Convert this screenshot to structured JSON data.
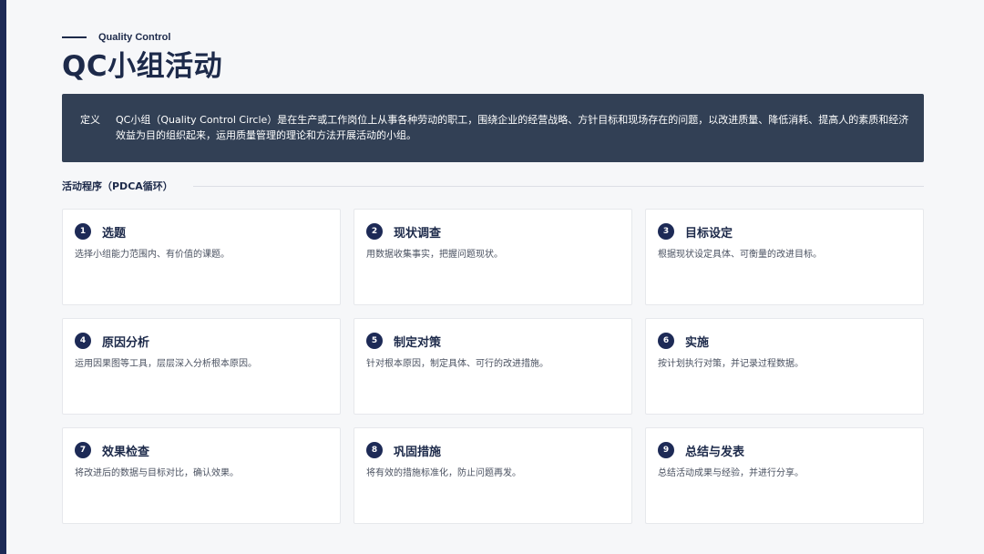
{
  "header": {
    "subtitle": "Quality Control",
    "title": "QC小组活动"
  },
  "definition": {
    "label": "定义",
    "text": "QC小组（Quality Control Circle）是在生产或工作岗位上从事各种劳动的职工，围绕企业的经营战略、方针目标和现场存在的问题，以改进质量、降低消耗、提高人的素质和经济效益为目的组织起来，运用质量管理的理论和方法开展活动的小组。"
  },
  "section": {
    "title": "活动程序（PDCA循环）"
  },
  "steps": [
    {
      "num": "1",
      "title": "选题",
      "desc": "选择小组能力范围内、有价值的课题。"
    },
    {
      "num": "2",
      "title": "现状调查",
      "desc": "用数据收集事实，把握问题现状。"
    },
    {
      "num": "3",
      "title": "目标设定",
      "desc": "根据现状设定具体、可衡量的改进目标。"
    },
    {
      "num": "4",
      "title": "原因分析",
      "desc": "运用因果图等工具，层层深入分析根本原因。"
    },
    {
      "num": "5",
      "title": "制定对策",
      "desc": "针对根本原因，制定具体、可行的改进措施。"
    },
    {
      "num": "6",
      "title": "实施",
      "desc": "按计划执行对策，并记录过程数据。"
    },
    {
      "num": "7",
      "title": "效果检查",
      "desc": "将改进后的数据与目标对比，确认效果。"
    },
    {
      "num": "8",
      "title": "巩固措施",
      "desc": "将有效的措施标准化，防止问题再发。"
    },
    {
      "num": "9",
      "title": "总结与发表",
      "desc": "总结活动成果与经验，并进行分享。"
    }
  ],
  "colors": {
    "accent": "#1d2a56",
    "definition_bg": "#324055",
    "page_bg": "#f6f7f9"
  }
}
